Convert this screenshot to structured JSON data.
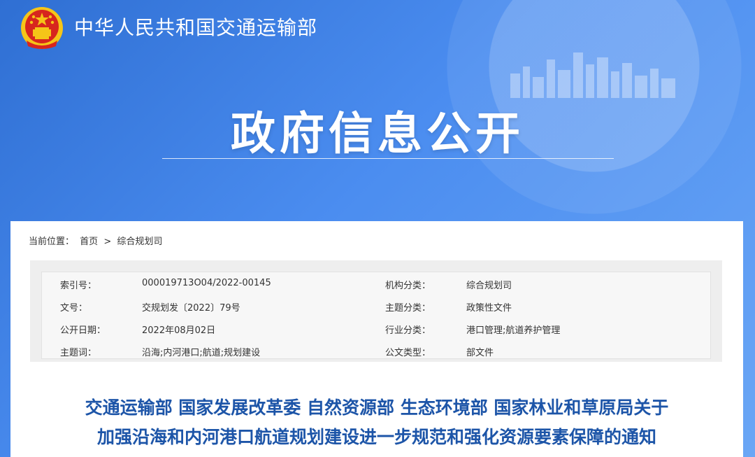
{
  "header": {
    "ministry_name": "中华人民共和国交通运输部",
    "emblem_icon": "national-emblem-icon",
    "section_title": "政府信息公开",
    "colors": {
      "banner": "#3a7bd8",
      "title_text": "#1d55a8",
      "emblem_red": "#d7261e",
      "emblem_gold": "#f5c518"
    }
  },
  "breadcrumb": {
    "label": "当前位置：",
    "home": "首页",
    "separator": ">",
    "current": "综合规划司"
  },
  "meta": {
    "rows": [
      {
        "k1": "索引号：",
        "v1": "000019713O04/2022-00145",
        "k2": "机构分类：",
        "v2": "综合规划司"
      },
      {
        "k1": "文号：",
        "v1": "交规划发〔2022〕79号",
        "k2": "主题分类：",
        "v2": "政策性文件"
      },
      {
        "k1": "公开日期：",
        "v1": "2022年08月02日",
        "k2": "行业分类：",
        "v2": "港口管理;航道养护管理"
      },
      {
        "k1": "主题词：",
        "v1": "沿海;内河港口;航道;规划建设",
        "k2": "公文类型：",
        "v2": "部文件"
      }
    ]
  },
  "document": {
    "title_line1": "交通运输部 国家发展改革委 自然资源部 生态环境部 国家林业和草原局关于",
    "title_line2": "加强沿海和内河港口航道规划建设进一步规范和强化资源要素保障的通知"
  }
}
